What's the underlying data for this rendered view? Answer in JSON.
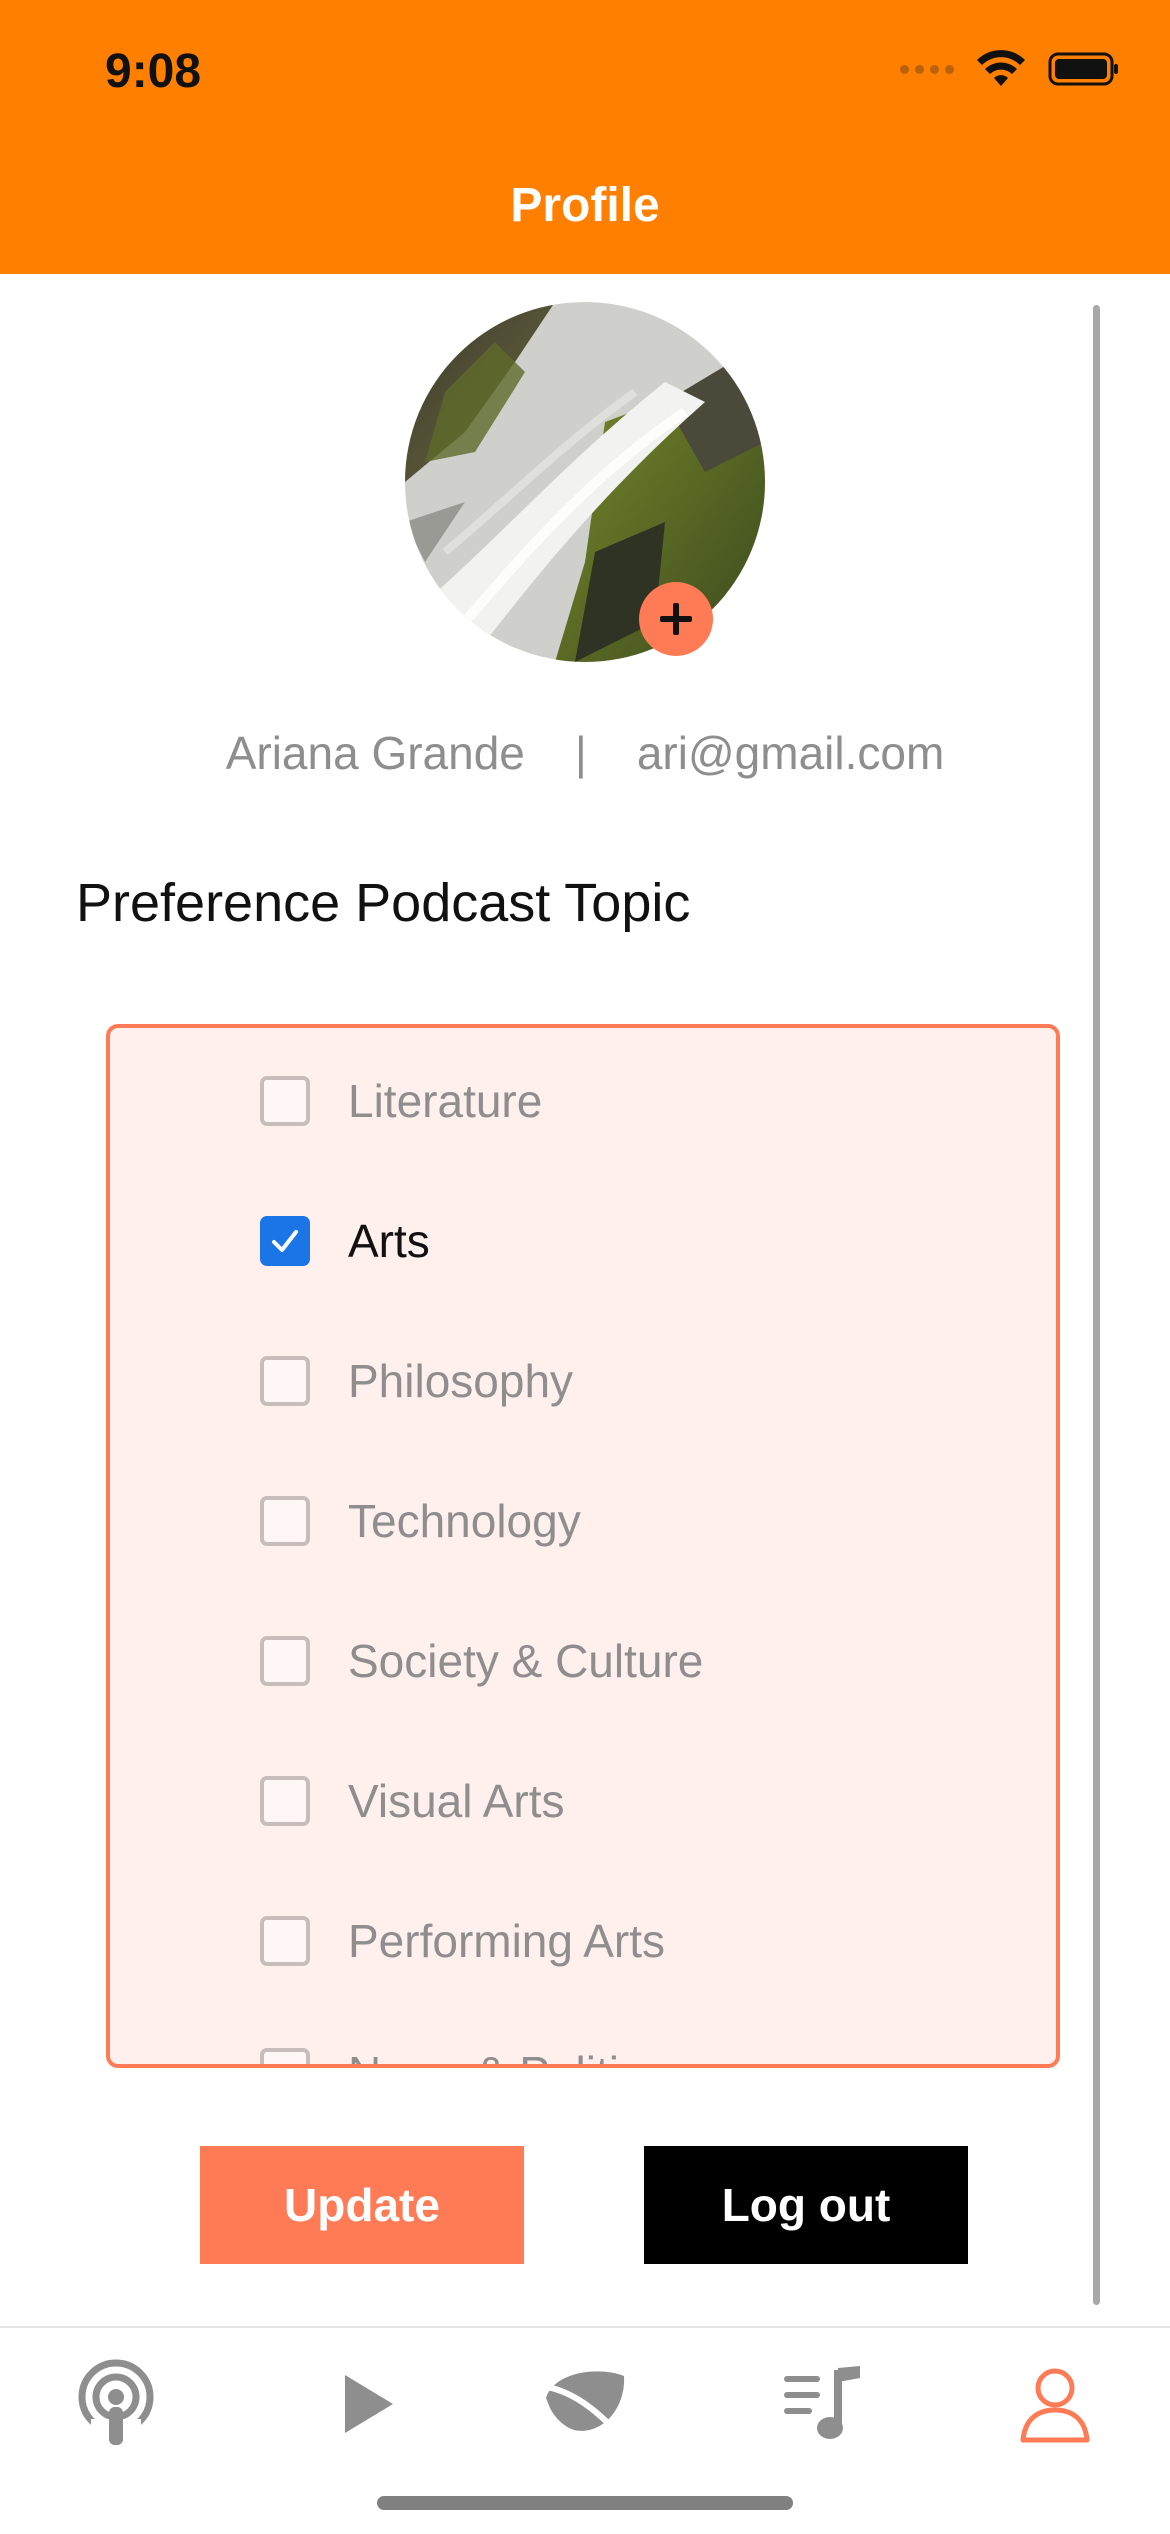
{
  "status_bar": {
    "time": "9:08"
  },
  "header": {
    "title": "Profile"
  },
  "profile": {
    "name": "Ariana Grande",
    "separator": "|",
    "email": "ari@gmail.com"
  },
  "preferences": {
    "title": "Preference Podcast Topic",
    "topics": [
      {
        "label": "Literature",
        "checked": false
      },
      {
        "label": "Arts",
        "checked": true
      },
      {
        "label": "Philosophy",
        "checked": false
      },
      {
        "label": "Technology",
        "checked": false
      },
      {
        "label": "Society & Culture",
        "checked": false
      },
      {
        "label": "Visual Arts",
        "checked": false
      },
      {
        "label": "Performing Arts",
        "checked": false
      },
      {
        "label": "News & Politics",
        "checked": false
      }
    ]
  },
  "actions": {
    "update_label": "Update",
    "logout_label": "Log out"
  },
  "tabbar": {
    "items": [
      {
        "icon": "podcast-icon",
        "active": false
      },
      {
        "icon": "play-icon",
        "active": false
      },
      {
        "icon": "leaf-icon",
        "active": false
      },
      {
        "icon": "playlist-icon",
        "active": false
      },
      {
        "icon": "profile-icon",
        "active": true
      }
    ]
  },
  "colors": {
    "header": "#FF7F00",
    "accent": "#FF7B55",
    "checkbox_checked": "#1B75E6",
    "inactive_icon": "#8e8e8e"
  }
}
